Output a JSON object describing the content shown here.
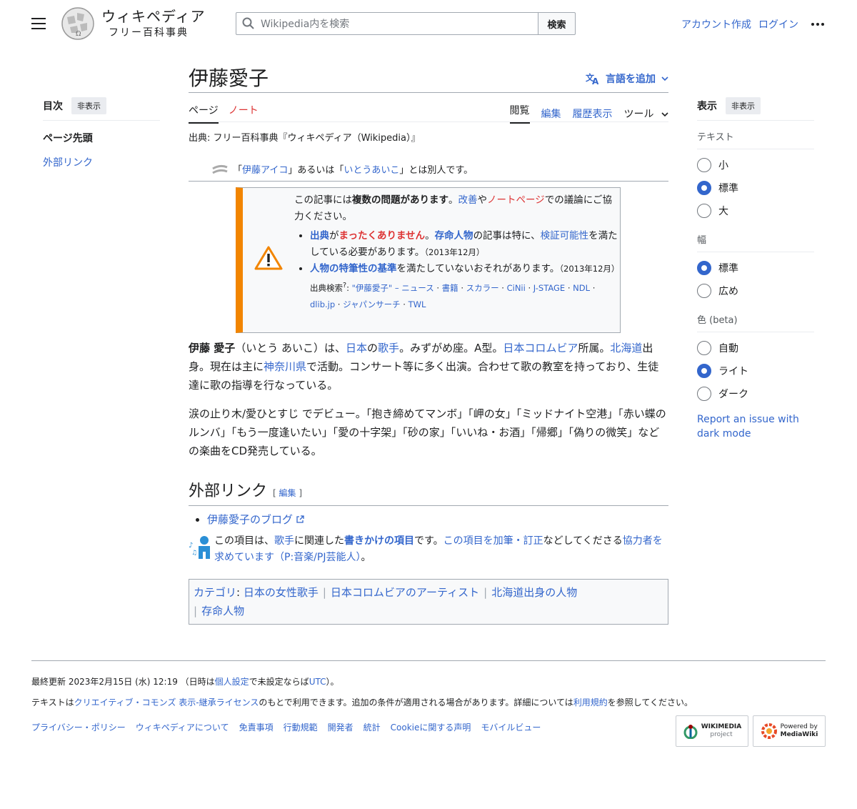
{
  "header": {
    "logo_title": "ウィキペディア",
    "logo_subtitle": "フリー百科事典",
    "search_placeholder": "Wikipedia内を検索",
    "search_button": "検索",
    "create_account": "アカウント作成",
    "login": "ログイン"
  },
  "toc": {
    "title": "目次",
    "hide": "非表示",
    "items": [
      "ページ先頭",
      "外部リンク"
    ]
  },
  "article": {
    "title": "伊藤愛子",
    "add_languages": "言語を追加",
    "tabs_left": [
      "ページ",
      "ノート"
    ],
    "tabs_right": [
      "閲覧",
      "編集",
      "履歴表示",
      "ツール"
    ],
    "from": "出典: フリー百科事典『ウィキペディア（Wikipedia）』",
    "hatnote": {
      "pre": "「",
      "link1": "伊藤アイコ",
      "mid": "」あるいは「",
      "link2": "いとうあいこ",
      "post": "」とは別人です。"
    },
    "ambox": {
      "line1_a": "この記事には",
      "line1_b": "複数の問題があります",
      "line1_c": "。",
      "improve": "改善",
      "ya": "や",
      "talk": "ノートページ",
      "line1_d": "での議論にご協力ください。",
      "b1_sources": "出典",
      "b1_ga": "が",
      "b1_none": "まったくありません",
      "b1_dot": "。",
      "b1_living": "存命人物",
      "b1_mid": "の記事は特に、",
      "b1_verify": "検証可能性",
      "b1_end": "を満たしている必要があります。",
      "b1_date": "（2013年12月）",
      "b2_link": "人物の特筆性の基準",
      "b2_text": "を満たしていないおそれがあります。",
      "b2_date": "（2013年12月）",
      "search_label": "出典検索",
      "search_links": [
        "\"伊藤愛子\" – ニュース",
        "書籍",
        "スカラー",
        "CiNii",
        "J-STAGE",
        "NDL",
        "dlib.jp",
        "ジャパンサーチ",
        "TWL"
      ]
    },
    "p1": {
      "name": "伊藤 愛子",
      "reading": "（いとう あいこ）は、",
      "japan": "日本",
      "no": "の",
      "singer": "歌手",
      "a": "。みずがめ座。A型。",
      "columbia": "日本コロムビア",
      "b": "所属。",
      "hokkaido": "北海道",
      "c": "出身。現在は主に",
      "kanagawa": "神奈川県",
      "d": "で活動。コンサート等に多く出演。合わせて歌の教室を持っており、生徒達に歌の指導を行なっている。"
    },
    "p2": "涙の止り木/愛ひとすじ でデビュー。「抱き締めてマンボ」「岬の女」「ミッドナイト空港」「赤い蝶のルンバ」「もう一度逢いたい」「愛の十字架」「砂の家」「いいね・お酒」「帰郷」「偽りの微笑」などの楽曲をCD発売している。",
    "section_title": "外部リンク",
    "section_edit": "編集",
    "ext_link": "伊藤愛子のブログ",
    "stub": {
      "a": "この項目は、",
      "singer": "歌手",
      "b": "に関連した",
      "stub_link": "書きかけの項目",
      "c": "です。",
      "edit_link": "この項目を加筆・訂正",
      "d": "などしてくださる",
      "help_link": "協力者を求めています",
      "project": "（P:音楽/PJ芸能人）",
      "e": "。"
    },
    "categories_label": "カテゴリ",
    "categories": [
      "日本の女性歌手",
      "日本コロムビアのアーティスト",
      "北海道出身の人物",
      "存命人物"
    ]
  },
  "appearance": {
    "title": "表示",
    "hide": "非表示",
    "text_label": "テキスト",
    "text_options": [
      "小",
      "標準",
      "大"
    ],
    "text_selected": 1,
    "width_label": "幅",
    "width_options": [
      "標準",
      "広め"
    ],
    "width_selected": 0,
    "color_label": "色 (beta)",
    "color_options": [
      "自動",
      "ライト",
      "ダーク"
    ],
    "color_selected": 1,
    "report": "Report an issue with dark mode"
  },
  "footer": {
    "updated_a": "最終更新 2023年2月15日 (水) 12:19 （日時は",
    "personal": "個人設定",
    "updated_b": "で未設定ならば",
    "utc": "UTC",
    "updated_c": "）。",
    "license_a": "テキストは",
    "license_link": "クリエイティブ・コモンズ 表示-継承ライセンス",
    "license_b": "のもとで利用できます。追加の条件が適用される場合があります。詳細については",
    "terms": "利用規約",
    "license_c": "を参照してください。",
    "links": [
      "プライバシー・ポリシー",
      "ウィキペディアについて",
      "免責事項",
      "行動規範",
      "開発者",
      "統計",
      "Cookieに関する声明",
      "モバイルビュー"
    ],
    "badge1_a": "WIKIMEDIA",
    "badge1_b": "project",
    "badge2_a": "Powered by",
    "badge2_b": "MediaWiki"
  }
}
